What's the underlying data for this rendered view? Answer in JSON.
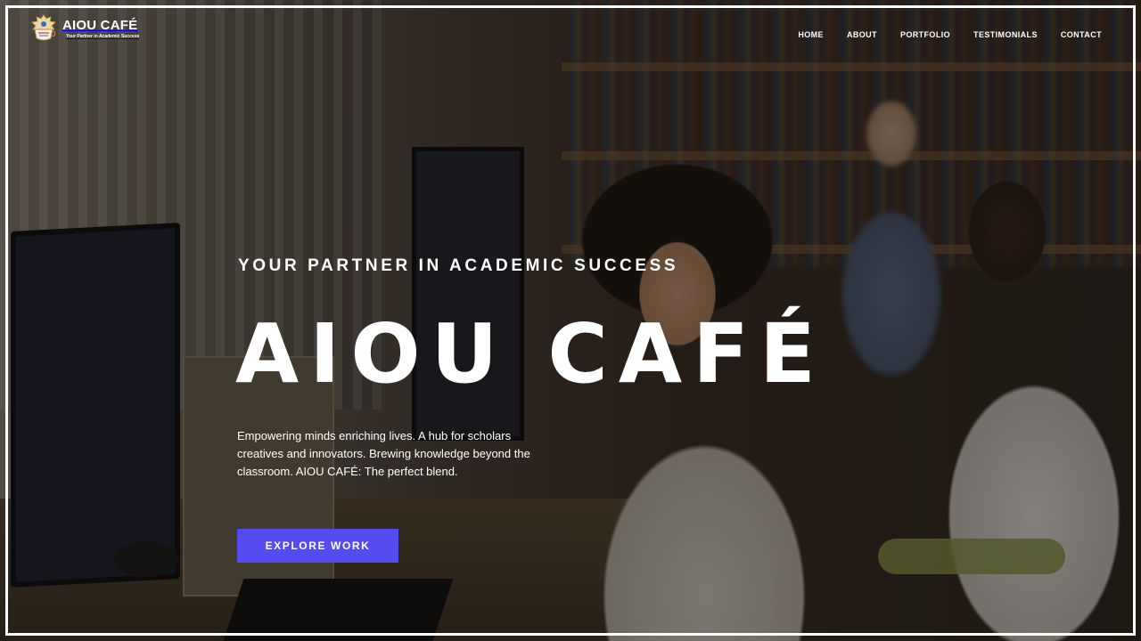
{
  "brand": {
    "name": "AIOU CAFÉ",
    "tagline": "Your Partner in Academic Success"
  },
  "nav": {
    "items": [
      {
        "label": "HOME"
      },
      {
        "label": "ABOUT"
      },
      {
        "label": "PORTFOLIO"
      },
      {
        "label": "TESTIMONIALS"
      },
      {
        "label": "CONTACT"
      }
    ]
  },
  "hero": {
    "eyebrow": "YOUR PARTNER IN ACADEMIC SUCCESS",
    "title": "AIOU CAFÉ",
    "description": "Empowering minds enriching lives. A hub for scholars creatives and innovators. Brewing knowledge beyond the classroom. AIOU CAFÉ: The perfect blend.",
    "cta_label": "EXPLORE WORK"
  },
  "colors": {
    "accent": "#544cf0",
    "text": "#ffffff",
    "frame": "#ffffff"
  },
  "icons": {
    "logo": "coffee-cup-crest-icon"
  }
}
